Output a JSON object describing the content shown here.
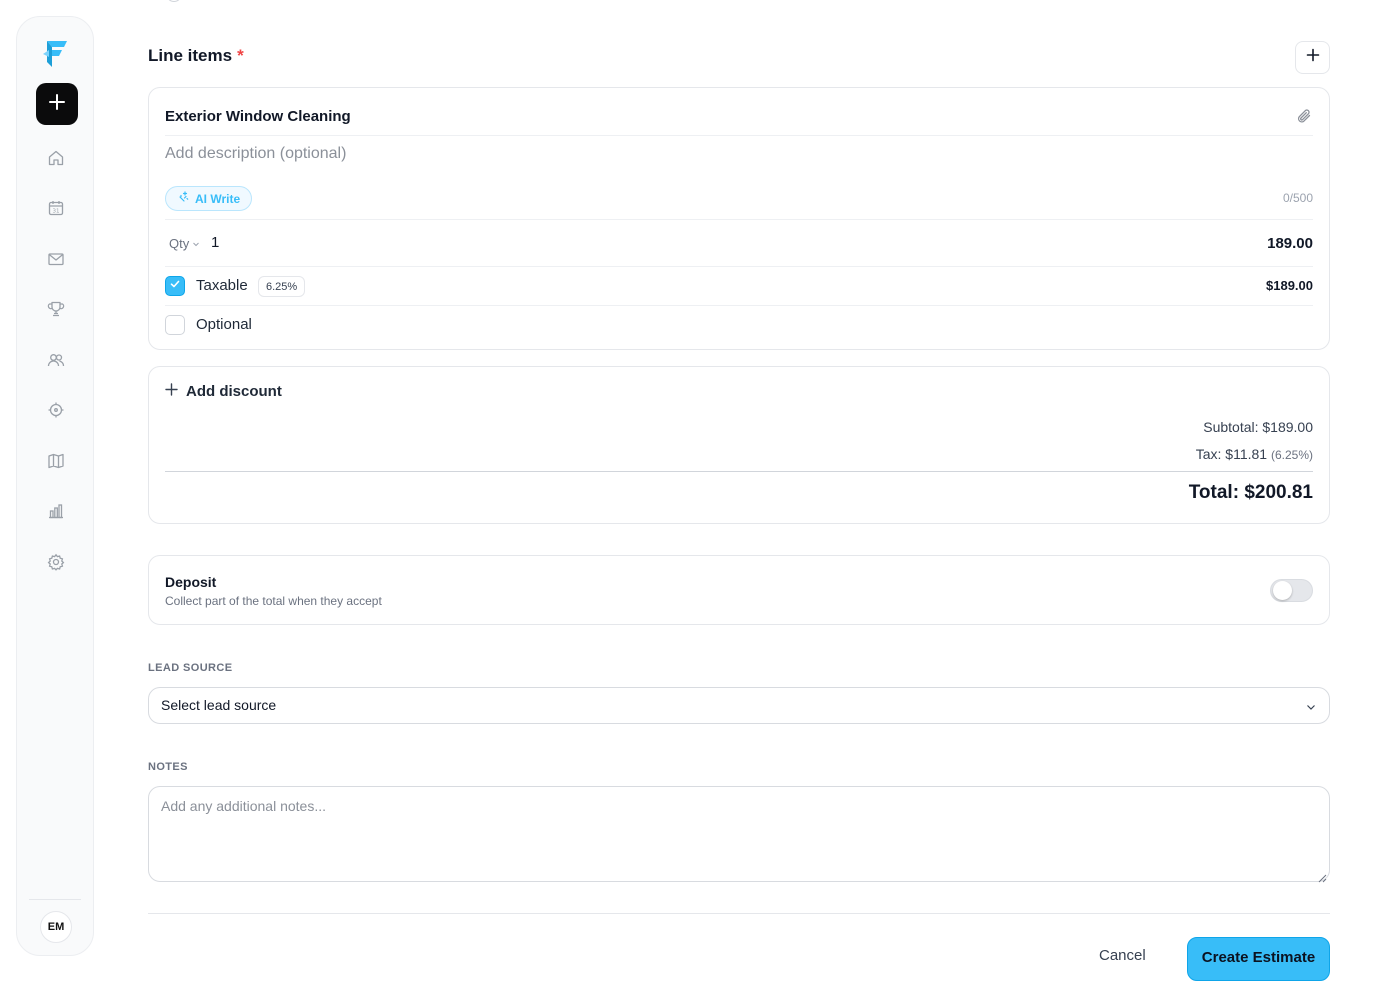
{
  "sidebar": {
    "new_button_icon": "plus-icon",
    "nav": [
      {
        "name": "home",
        "icon": "home-icon"
      },
      {
        "name": "calendar",
        "icon": "calendar-icon",
        "calendar_day": "31"
      },
      {
        "name": "inbox",
        "icon": "mail-icon"
      },
      {
        "name": "rewards",
        "icon": "trophy-icon"
      },
      {
        "name": "customers",
        "icon": "users-icon"
      },
      {
        "name": "target",
        "icon": "crosshair-icon"
      },
      {
        "name": "map",
        "icon": "map-icon"
      },
      {
        "name": "reports",
        "icon": "bar-chart-icon"
      },
      {
        "name": "settings",
        "icon": "gear-icon"
      }
    ],
    "avatar": "EM"
  },
  "line_items": {
    "title": "Line items",
    "required_mark": "*",
    "item": {
      "name": "Exterior Window Cleaning",
      "description_placeholder": "Add description (optional)",
      "ai_write_label": "AI Write",
      "char_count": "0/500",
      "qty_label": "Qty",
      "qty": "1",
      "price": "189.00",
      "taxable_label": "Taxable",
      "taxable_checked": true,
      "tax_rate": "6.25%",
      "line_total": "$189.00",
      "optional_label": "Optional",
      "optional_checked": false
    }
  },
  "summary": {
    "add_discount_label": "Add discount",
    "subtotal": "Subtotal: $189.00",
    "tax": "Tax: $11.81",
    "tax_rate": "(6.25%)",
    "total": "Total: $200.81"
  },
  "deposit": {
    "title": "Deposit",
    "subtitle": "Collect part of the total when they accept",
    "enabled": false
  },
  "lead_source": {
    "label": "LEAD SOURCE",
    "value": "Select lead source"
  },
  "notes": {
    "label": "NOTES",
    "placeholder": "Add any additional notes..."
  },
  "footer": {
    "cancel_label": "Cancel",
    "create_label": "Create Estimate"
  },
  "colors": {
    "accent": "#38bdf8",
    "required": "#ef4444",
    "primary_dark": "#0b0b0c"
  }
}
